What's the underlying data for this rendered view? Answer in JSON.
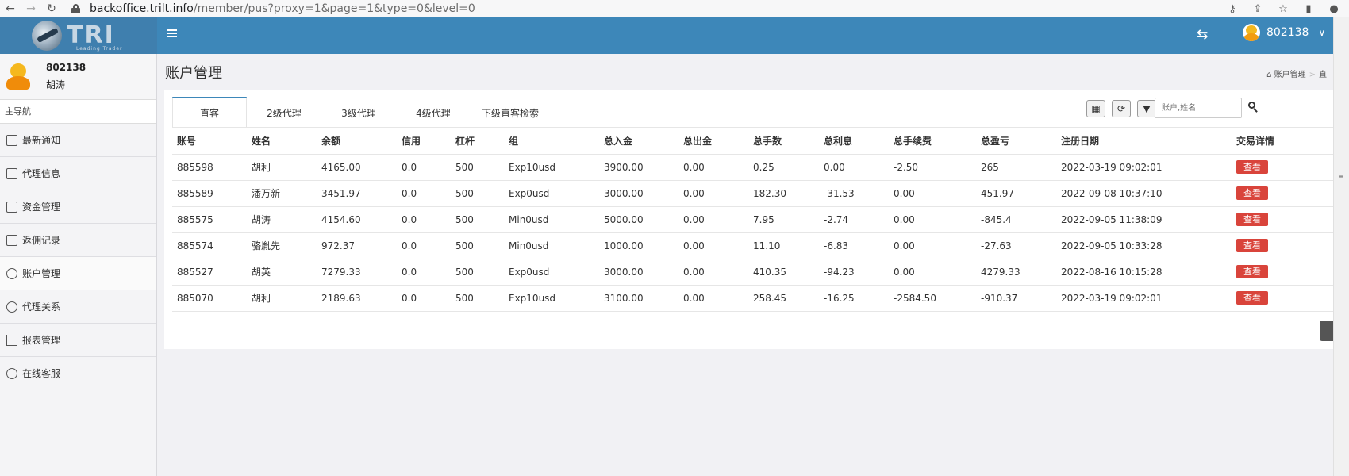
{
  "browser": {
    "url_host": "backoffice.trilt.info",
    "url_path": "/member/pus?proxy=1&page=1&type=0&level=0"
  },
  "header": {
    "logo_text": "TRI",
    "logo_sub": "Leading Trader",
    "user_id": "802138"
  },
  "sidebar": {
    "profile_id": "802138",
    "profile_name": "胡涛",
    "nav_title": "主导航",
    "items": [
      {
        "label": "最新通知",
        "icon": "megaphone-icon"
      },
      {
        "label": "代理信息",
        "icon": "user-card-icon"
      },
      {
        "label": "资金管理",
        "icon": "copy-icon"
      },
      {
        "label": "返佣记录",
        "icon": "hand-coin-icon"
      },
      {
        "label": "账户管理",
        "icon": "user-icon"
      },
      {
        "label": "代理关系",
        "icon": "users-icon"
      },
      {
        "label": "报表管理",
        "icon": "chart-icon"
      },
      {
        "label": "在线客服",
        "icon": "person-icon"
      }
    ]
  },
  "main": {
    "page_title": "账户管理",
    "breadcrumb": [
      "账户管理",
      "直"
    ],
    "tabs": [
      "直客",
      "2级代理",
      "3级代理",
      "4级代理",
      "下级直客检索"
    ],
    "search_placeholder": "账户,姓名",
    "table": {
      "columns": [
        "账号",
        "姓名",
        "余额",
        "信用",
        "杠杆",
        "组",
        "总入金",
        "总出金",
        "总手数",
        "总利息",
        "总手续费",
        "总盈亏",
        "注册日期",
        "交易详情"
      ],
      "view_label": "查看",
      "rows": [
        [
          "885598",
          "胡利",
          "4165.00",
          "0.0",
          "500",
          "Exp10usd",
          "3900.00",
          "0.00",
          "0.25",
          "0.00",
          "-2.50",
          "265",
          "2022-03-19 09:02:01"
        ],
        [
          "885589",
          "潘万新",
          "3451.97",
          "0.0",
          "500",
          "Exp0usd",
          "3000.00",
          "0.00",
          "182.30",
          "-31.53",
          "0.00",
          "451.97",
          "2022-09-08 10:37:10"
        ],
        [
          "885575",
          "胡涛",
          "4154.60",
          "0.0",
          "500",
          "Min0usd",
          "5000.00",
          "0.00",
          "7.95",
          "-2.74",
          "0.00",
          "-845.4",
          "2022-09-05 11:38:09"
        ],
        [
          "885574",
          "骆胤先",
          "972.37",
          "0.0",
          "500",
          "Min0usd",
          "1000.00",
          "0.00",
          "11.10",
          "-6.83",
          "0.00",
          "-27.63",
          "2022-09-05 10:33:28"
        ],
        [
          "885527",
          "胡英",
          "7279.33",
          "0.0",
          "500",
          "Exp0usd",
          "3000.00",
          "0.00",
          "410.35",
          "-94.23",
          "0.00",
          "4279.33",
          "2022-08-16 10:15:28"
        ],
        [
          "885070",
          "胡利",
          "2189.63",
          "0.0",
          "500",
          "Exp10usd",
          "3100.00",
          "0.00",
          "258.45",
          "-16.25",
          "-2584.50",
          "-910.37",
          "2022-03-19 09:02:01"
        ]
      ]
    }
  }
}
